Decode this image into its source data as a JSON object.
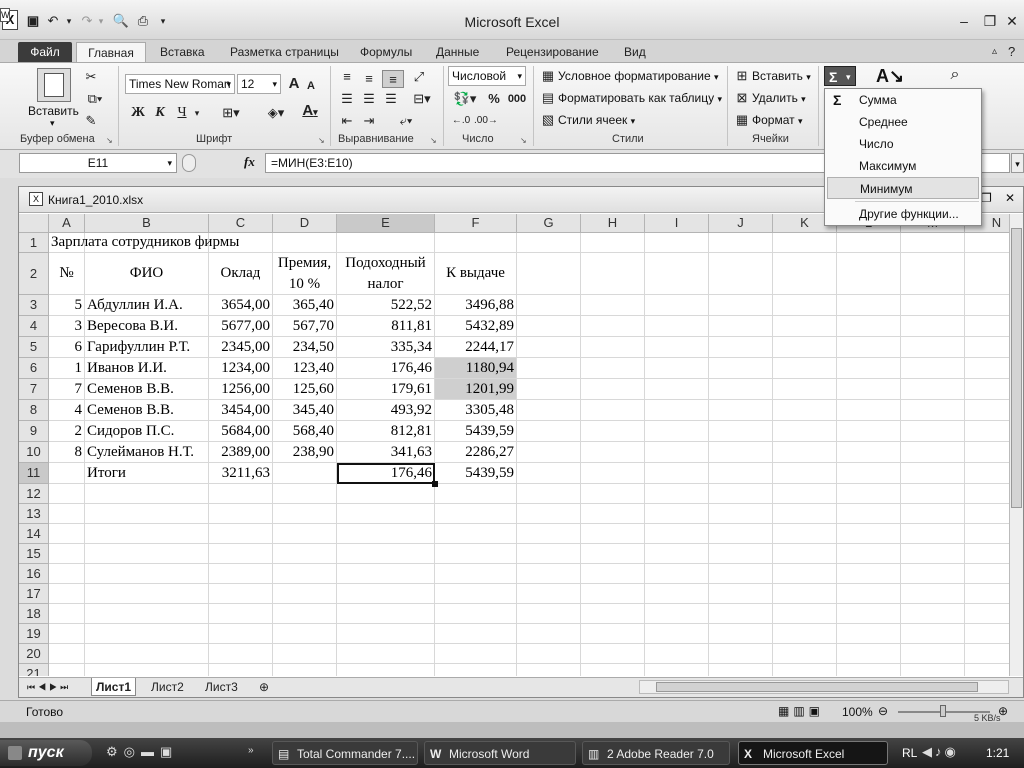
{
  "window": {
    "title": "Microsoft Excel",
    "app_icon_letter": "X"
  },
  "ribbon_tabs": [
    "Файл",
    "Главная",
    "Вставка",
    "Разметка страницы",
    "Формулы",
    "Данные",
    "Рецензирование",
    "Вид"
  ],
  "clipboard": {
    "paste_label": "Вставить",
    "group": "Буфер обмена"
  },
  "font": {
    "name": "Times New Roman",
    "size": "12",
    "bold": "Ж",
    "italic": "К",
    "underline": "Ч",
    "group": "Шрифт",
    "grow": "A",
    "color_letter": "A"
  },
  "alignment": {
    "group": "Выравнивание"
  },
  "number": {
    "format": "Числовой",
    "percent": "%",
    "thousands": "000",
    "group": "Число"
  },
  "styles": {
    "conditional": "Условное форматирование",
    "as_table": "Форматировать как таблицу",
    "cell_styles": "Стили ячеек",
    "group": "Стили"
  },
  "cells": {
    "insert": "Вставить",
    "delete": "Удалить",
    "format": "Формат",
    "group": "Ячейки"
  },
  "editing": {
    "sigma": "Σ"
  },
  "autosum_menu": {
    "items": [
      "Сумма",
      "Среднее",
      "Число",
      "Максимум",
      "Минимум",
      "Другие функции..."
    ],
    "hovered_index": 4,
    "sigma": "Σ"
  },
  "formula_bar": {
    "name_box": "E11",
    "fx": "fx",
    "formula": "=МИН(E3:E10)"
  },
  "workbook": {
    "filename": "Книга1_2010.xlsx"
  },
  "grid": {
    "columns": [
      "A",
      "B",
      "C",
      "D",
      "E",
      "F",
      "G",
      "H",
      "I",
      "J",
      "K",
      "L",
      "M",
      "N"
    ],
    "rows": [
      "1",
      "2",
      "3",
      "4",
      "5",
      "6",
      "7",
      "8",
      "9",
      "10",
      "11",
      "12",
      "13",
      "14",
      "15",
      "16",
      "17",
      "18",
      "19",
      "20",
      "21"
    ],
    "active_cell": "E11",
    "title": "Зарплата сотрудников фирмы",
    "headers": {
      "num": "№",
      "name": "ФИО",
      "salary": "Оклад",
      "bonus_1": "Премия,",
      "bonus_2": "10 %",
      "tax_1": "Подоходный",
      "tax_2": "налог",
      "payout": "К выдаче"
    },
    "data": [
      [
        "5",
        "Абдуллин И.А.",
        "3654,00",
        "365,40",
        "522,52",
        "3496,88"
      ],
      [
        "3",
        "Вересова В.И.",
        "5677,00",
        "567,70",
        "811,81",
        "5432,89"
      ],
      [
        "6",
        "Гарифуллин Р.Т.",
        "2345,00",
        "234,50",
        "335,34",
        "2244,17"
      ],
      [
        "1",
        "Иванов И.И.",
        "1234,00",
        "123,40",
        "176,46",
        "1180,94"
      ],
      [
        "7",
        "Семенов В.В.",
        "1256,00",
        "125,60",
        "179,61",
        "1201,99"
      ],
      [
        "4",
        "Семенов В.В.",
        "3454,00",
        "345,40",
        "493,92",
        "3305,48"
      ],
      [
        "2",
        "Сидоров П.С.",
        "5684,00",
        "568,40",
        "812,81",
        "5439,59"
      ],
      [
        "8",
        "Сулейманов Н.Т.",
        "2389,00",
        "238,90",
        "341,63",
        "2286,27"
      ]
    ],
    "totals": {
      "label": "Итоги",
      "salary": "3211,63",
      "tax": "176,46",
      "payout": "5439,59"
    }
  },
  "sheets": {
    "tabs": [
      "Лист1",
      "Лист2",
      "Лист3"
    ],
    "active": "Лист1"
  },
  "status": {
    "ready": "Готово",
    "zoom": "100%",
    "net": "5 KB/s"
  },
  "taskbar": {
    "start": "пуск",
    "items": [
      "Total Commander 7....",
      "Microsoft Word",
      "2 Adobe Reader 7.0",
      "Microsoft Excel"
    ],
    "active_index": 3,
    "lang": "RL",
    "clock": "1:21"
  }
}
